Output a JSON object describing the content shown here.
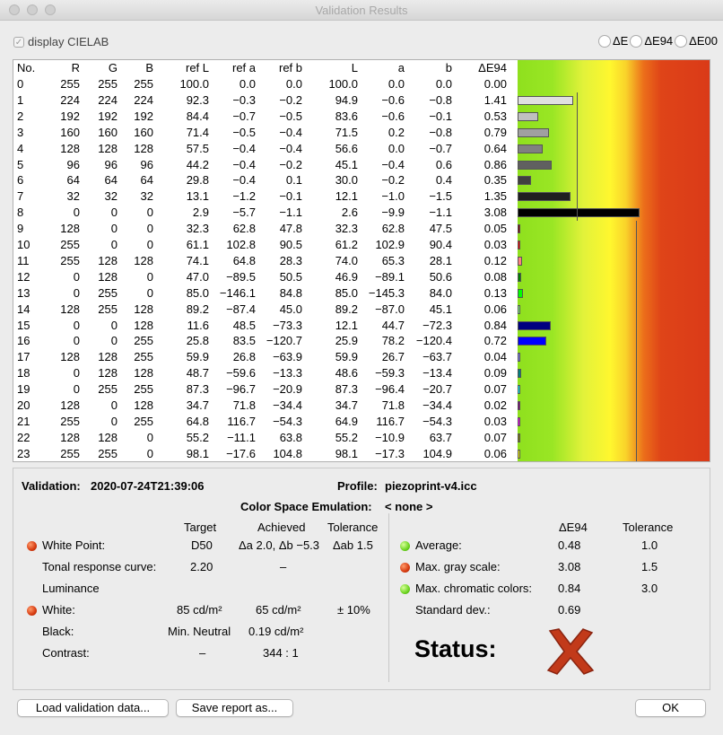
{
  "window": {
    "title": "Validation Results"
  },
  "options": {
    "display_cielab_label": "display CIELAB",
    "radios": [
      {
        "label": "ΔE"
      },
      {
        "label": "ΔE94"
      },
      {
        "label": "ΔE00"
      }
    ]
  },
  "table": {
    "headers": [
      "No.",
      "R",
      "G",
      "B",
      "ref L",
      "ref a",
      "ref b",
      "L",
      "a",
      "b",
      "ΔE94"
    ],
    "rows": [
      {
        "no": "0",
        "r": "255",
        "g": "255",
        "b": "255",
        "refL": "100.0",
        "refA": "0.0",
        "refB": "0.0",
        "L": "100.0",
        "a": "0.0",
        "bb": "0.0",
        "de": "0.00",
        "color": "#ffffff"
      },
      {
        "no": "1",
        "r": "224",
        "g": "224",
        "b": "224",
        "refL": "92.3",
        "refA": "−0.3",
        "refB": "−0.2",
        "L": "94.9",
        "a": "−0.6",
        "bb": "−0.8",
        "de": "1.41",
        "color": "#e0e0e0"
      },
      {
        "no": "2",
        "r": "192",
        "g": "192",
        "b": "192",
        "refL": "84.4",
        "refA": "−0.7",
        "refB": "−0.5",
        "L": "83.6",
        "a": "−0.6",
        "bb": "−0.1",
        "de": "0.53",
        "color": "#c0c0c0"
      },
      {
        "no": "3",
        "r": "160",
        "g": "160",
        "b": "160",
        "refL": "71.4",
        "refA": "−0.5",
        "refB": "−0.4",
        "L": "71.5",
        "a": "0.2",
        "bb": "−0.8",
        "de": "0.79",
        "color": "#a0a0a0"
      },
      {
        "no": "4",
        "r": "128",
        "g": "128",
        "b": "128",
        "refL": "57.5",
        "refA": "−0.4",
        "refB": "−0.4",
        "L": "56.6",
        "a": "0.0",
        "bb": "−0.7",
        "de": "0.64",
        "color": "#808080"
      },
      {
        "no": "5",
        "r": "96",
        "g": "96",
        "b": "96",
        "refL": "44.2",
        "refA": "−0.4",
        "refB": "−0.2",
        "L": "45.1",
        "a": "−0.4",
        "bb": "0.6",
        "de": "0.86",
        "color": "#606060"
      },
      {
        "no": "6",
        "r": "64",
        "g": "64",
        "b": "64",
        "refL": "29.8",
        "refA": "−0.4",
        "refB": "0.1",
        "L": "30.0",
        "a": "−0.2",
        "bb": "0.4",
        "de": "0.35",
        "color": "#404040"
      },
      {
        "no": "7",
        "r": "32",
        "g": "32",
        "b": "32",
        "refL": "13.1",
        "refA": "−1.2",
        "refB": "−0.1",
        "L": "12.1",
        "a": "−1.0",
        "bb": "−1.5",
        "de": "1.35",
        "color": "#202020"
      },
      {
        "no": "8",
        "r": "0",
        "g": "0",
        "b": "0",
        "refL": "2.9",
        "refA": "−5.7",
        "refB": "−1.1",
        "L": "2.6",
        "a": "−9.9",
        "bb": "−1.1",
        "de": "3.08",
        "color": "#000000"
      },
      {
        "no": "9",
        "r": "128",
        "g": "0",
        "b": "0",
        "refL": "32.3",
        "refA": "62.8",
        "refB": "47.8",
        "L": "32.3",
        "a": "62.8",
        "bb": "47.5",
        "de": "0.05",
        "color": "#800000"
      },
      {
        "no": "10",
        "r": "255",
        "g": "0",
        "b": "0",
        "refL": "61.1",
        "refA": "102.8",
        "refB": "90.5",
        "L": "61.2",
        "a": "102.9",
        "bb": "90.4",
        "de": "0.03",
        "color": "#ff0000"
      },
      {
        "no": "11",
        "r": "255",
        "g": "128",
        "b": "128",
        "refL": "74.1",
        "refA": "64.8",
        "refB": "28.3",
        "L": "74.0",
        "a": "65.3",
        "bb": "28.1",
        "de": "0.12",
        "color": "#ff8080"
      },
      {
        "no": "12",
        "r": "0",
        "g": "128",
        "b": "0",
        "refL": "47.0",
        "refA": "−89.5",
        "refB": "50.5",
        "L": "46.9",
        "a": "−89.1",
        "bb": "50.6",
        "de": "0.08",
        "color": "#008000"
      },
      {
        "no": "13",
        "r": "0",
        "g": "255",
        "b": "0",
        "refL": "85.0",
        "refA": "−146.1",
        "refB": "84.8",
        "L": "85.0",
        "a": "−145.3",
        "bb": "84.0",
        "de": "0.13",
        "color": "#00ff00"
      },
      {
        "no": "14",
        "r": "128",
        "g": "255",
        "b": "128",
        "refL": "89.2",
        "refA": "−87.4",
        "refB": "45.0",
        "L": "89.2",
        "a": "−87.0",
        "bb": "45.1",
        "de": "0.06",
        "color": "#80ff80"
      },
      {
        "no": "15",
        "r": "0",
        "g": "0",
        "b": "128",
        "refL": "11.6",
        "refA": "48.5",
        "refB": "−73.3",
        "L": "12.1",
        "a": "44.7",
        "bb": "−72.3",
        "de": "0.84",
        "color": "#000080"
      },
      {
        "no": "16",
        "r": "0",
        "g": "0",
        "b": "255",
        "refL": "25.8",
        "refA": "83.5",
        "refB": "−120.7",
        "L": "25.9",
        "a": "78.2",
        "bb": "−120.4",
        "de": "0.72",
        "color": "#0000ff"
      },
      {
        "no": "17",
        "r": "128",
        "g": "128",
        "b": "255",
        "refL": "59.9",
        "refA": "26.8",
        "refB": "−63.9",
        "L": "59.9",
        "a": "26.7",
        "bb": "−63.7",
        "de": "0.04",
        "color": "#8080ff"
      },
      {
        "no": "18",
        "r": "0",
        "g": "128",
        "b": "128",
        "refL": "48.7",
        "refA": "−59.6",
        "refB": "−13.3",
        "L": "48.6",
        "a": "−59.3",
        "bb": "−13.4",
        "de": "0.09",
        "color": "#008080"
      },
      {
        "no": "19",
        "r": "0",
        "g": "255",
        "b": "255",
        "refL": "87.3",
        "refA": "−96.7",
        "refB": "−20.9",
        "L": "87.3",
        "a": "−96.4",
        "bb": "−20.7",
        "de": "0.07",
        "color": "#00ffff"
      },
      {
        "no": "20",
        "r": "128",
        "g": "0",
        "b": "128",
        "refL": "34.7",
        "refA": "71.8",
        "refB": "−34.4",
        "L": "34.7",
        "a": "71.8",
        "bb": "−34.4",
        "de": "0.02",
        "color": "#800080"
      },
      {
        "no": "21",
        "r": "255",
        "g": "0",
        "b": "255",
        "refL": "64.8",
        "refA": "116.7",
        "refB": "−54.3",
        "L": "64.9",
        "a": "116.7",
        "bb": "−54.3",
        "de": "0.03",
        "color": "#ff00ff"
      },
      {
        "no": "22",
        "r": "128",
        "g": "128",
        "b": "0",
        "refL": "55.2",
        "refA": "−11.1",
        "refB": "63.8",
        "L": "55.2",
        "a": "−10.9",
        "bb": "63.7",
        "de": "0.07",
        "color": "#808000"
      },
      {
        "no": "23",
        "r": "255",
        "g": "255",
        "b": "0",
        "refL": "98.1",
        "refA": "−17.6",
        "refB": "104.8",
        "L": "98.1",
        "a": "−17.3",
        "bb": "104.9",
        "de": "0.06",
        "color": "#ffff00"
      }
    ]
  },
  "summary": {
    "validation_label": "Validation:",
    "validation_date": "2020-07-24T21:39:06",
    "profile_label": "Profile:",
    "profile_value": "piezoprint-v4.icc",
    "emulation_label": "Color Space Emulation:",
    "emulation_value": "< none >",
    "left_headers": {
      "target": "Target",
      "achieved": "Achieved",
      "tolerance": "Tolerance"
    },
    "white_point": {
      "label": "White Point:",
      "target": "D50",
      "achieved": "Δa 2.0, Δb −5.3",
      "tolerance": "Δab 1.5"
    },
    "trc": {
      "label": "Tonal response curve:",
      "target": "2.20",
      "achieved": "–"
    },
    "luminance_label": "Luminance",
    "white": {
      "label": "White:",
      "target": "85 cd/m²",
      "achieved": "65 cd/m²",
      "tolerance": "± 10%"
    },
    "black": {
      "label": "Black:",
      "target": "Min. Neutral",
      "achieved": "0.19 cd/m²"
    },
    "contrast": {
      "label": "Contrast:",
      "target": "–",
      "achieved": "344 : 1"
    },
    "right_headers": {
      "de": "ΔE94",
      "tolerance": "Tolerance"
    },
    "average": {
      "label": "Average:",
      "value": "0.48",
      "tolerance": "1.0"
    },
    "max_gray": {
      "label": "Max. gray scale:",
      "value": "3.08",
      "tolerance": "1.5"
    },
    "max_chroma": {
      "label": "Max. chromatic colors:",
      "value": "0.84",
      "tolerance": "3.0"
    },
    "stddev": {
      "label": "Standard dev.:",
      "value": "0.69"
    },
    "status_label": "Status:"
  },
  "buttons": {
    "load": "Load validation data...",
    "save": "Save report as...",
    "ok": "OK"
  },
  "colors": {
    "status_fail": "#c23a1a",
    "gradient_green": "#8fe01e",
    "gradient_yellow": "#fff72e",
    "gradient_red": "#da3a18"
  }
}
